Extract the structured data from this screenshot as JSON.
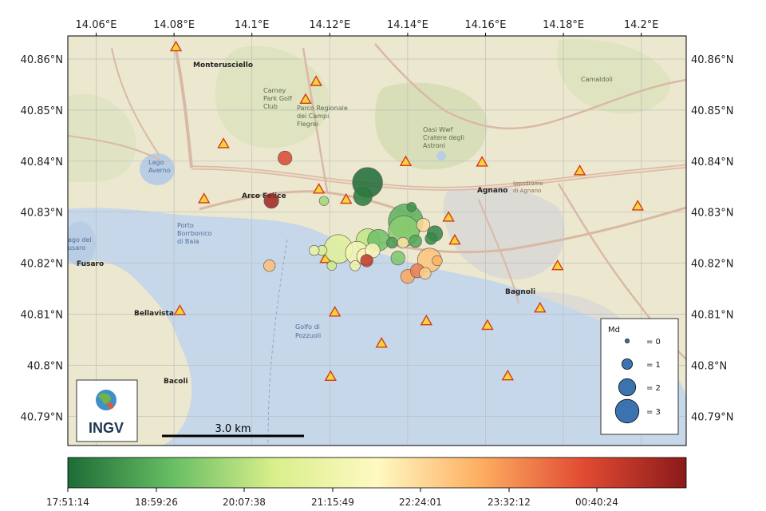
{
  "axes": {
    "lon_ticks": [
      "14.06°E",
      "14.08°E",
      "14.1°E",
      "14.12°E",
      "14.14°E",
      "14.16°E",
      "14.18°E",
      "14.2°E"
    ],
    "lat_ticks_left": [
      "40.86°N",
      "40.85°N",
      "40.84°N",
      "40.83°N",
      "40.82°N",
      "40.81°N",
      "40.8°N",
      "40.79°N"
    ],
    "lat_ticks_right": [
      "40.86°N",
      "40.85°N",
      "40.84°N",
      "40.83°N",
      "40.82°N",
      "40.81°N",
      "40.8°N",
      "40.79°N"
    ]
  },
  "places": {
    "monterusciello": "Monterusciello",
    "arco_felice": "Arco Felice",
    "agnano": "Agnano",
    "bagnoli": "Bagnoli",
    "bellavista": "Bellavista",
    "bacoli": "Bacoli",
    "fusaro": "Fusaro",
    "camaldoli": "Camaldoli",
    "lago_averno": "Lago\nAverno",
    "golfo": "Golfo di\nPozzuoli",
    "oasi": "Oasi Wwf\nCratere degli\nAstroni",
    "parco": "Parco Regionale\ndei Campi\nFlegrei",
    "golf": "Carney\nPark Golf\nClub",
    "ippodromo": "Ippodromo\ndi Agnano",
    "porto": "Porto\nBorrbonico\ndi Baia",
    "lago_del": "ago del\nusaro"
  },
  "scale_bar": {
    "label": "3.0 km"
  },
  "logo": {
    "text": "INGV"
  },
  "legend": {
    "title": "Md",
    "entries": [
      {
        "label": "= 0",
        "md": 0
      },
      {
        "label": "= 1",
        "md": 1
      },
      {
        "label": "= 2",
        "md": 2
      },
      {
        "label": "= 3",
        "md": 3
      }
    ]
  },
  "colorbar": {
    "colors": [
      "#1d6b36",
      "#66bd63",
      "#d9ef8b",
      "#fff9c2",
      "#fdae61",
      "#e24b33",
      "#8b1a1a"
    ],
    "ticks": [
      "17:51:14",
      "18:59:26",
      "20:07:38",
      "21:15:49",
      "22:24:01",
      "23:32:12",
      "00:40:24"
    ]
  },
  "stations": [
    {
      "lon": 14.0805,
      "lat": 40.8624
    },
    {
      "lon": 14.1165,
      "lat": 40.8556
    },
    {
      "lon": 14.1138,
      "lat": 40.8521
    },
    {
      "lon": 14.0927,
      "lat": 40.8434
    },
    {
      "lon": 14.0877,
      "lat": 40.8326
    },
    {
      "lon": 14.1172,
      "lat": 40.8345
    },
    {
      "lon": 14.1242,
      "lat": 40.8325
    },
    {
      "lon": 14.1395,
      "lat": 40.8399
    },
    {
      "lon": 14.1591,
      "lat": 40.8398
    },
    {
      "lon": 14.1842,
      "lat": 40.8381
    },
    {
      "lon": 14.1991,
      "lat": 40.8312
    },
    {
      "lon": 14.1505,
      "lat": 40.829
    },
    {
      "lon": 14.1521,
      "lat": 40.8245
    },
    {
      "lon": 14.1189,
      "lat": 40.8209
    },
    {
      "lon": 14.1785,
      "lat": 40.8195
    },
    {
      "lon": 14.0815,
      "lat": 40.8107
    },
    {
      "lon": 14.1213,
      "lat": 40.8104
    },
    {
      "lon": 14.174,
      "lat": 40.8112
    },
    {
      "lon": 14.1448,
      "lat": 40.8087
    },
    {
      "lon": 14.1605,
      "lat": 40.8078
    },
    {
      "lon": 14.1333,
      "lat": 40.8043
    },
    {
      "lon": 14.1202,
      "lat": 40.7978
    },
    {
      "lon": 14.1657,
      "lat": 40.7979
    },
    {
      "lon": 14.1395,
      "lat": 40.8272
    }
  ],
  "events": [
    {
      "lon": 14.1297,
      "lat": 40.8358,
      "md": 3.3,
      "t": 0.0
    },
    {
      "lon": 14.1285,
      "lat": 40.8331,
      "md": 1.8,
      "t": 0.03
    },
    {
      "lon": 14.1395,
      "lat": 40.8282,
      "md": 3.9,
      "t": 0.14
    },
    {
      "lon": 14.139,
      "lat": 40.8263,
      "md": 3.4,
      "t": 0.22
    },
    {
      "lon": 14.1298,
      "lat": 40.8244,
      "md": 2.5,
      "t": 0.3
    },
    {
      "lon": 14.1325,
      "lat": 40.8245,
      "md": 2.2,
      "t": 0.18
    },
    {
      "lon": 14.1222,
      "lat": 40.8228,
      "md": 3.1,
      "t": 0.37
    },
    {
      "lon": 14.127,
      "lat": 40.822,
      "md": 2.4,
      "t": 0.45
    },
    {
      "lon": 14.129,
      "lat": 40.8213,
      "md": 1.5,
      "t": 0.52
    },
    {
      "lon": 14.131,
      "lat": 40.8225,
      "md": 1.3,
      "t": 0.48
    },
    {
      "lon": 14.1375,
      "lat": 40.821,
      "md": 1.2,
      "t": 0.2
    },
    {
      "lon": 14.1456,
      "lat": 40.8206,
      "md": 2.5,
      "t": 0.62
    },
    {
      "lon": 14.147,
      "lat": 40.8258,
      "md": 1.4,
      "t": 0.05
    },
    {
      "lon": 14.144,
      "lat": 40.8275,
      "md": 1.1,
      "t": 0.57
    },
    {
      "lon": 14.146,
      "lat": 40.8248,
      "md": 0.9,
      "t": 0.06
    },
    {
      "lon": 14.142,
      "lat": 40.8243,
      "md": 1.0,
      "t": 0.12
    },
    {
      "lon": 14.14,
      "lat": 40.8174,
      "md": 1.2,
      "t": 0.68
    },
    {
      "lon": 14.1425,
      "lat": 40.8185,
      "md": 1.2,
      "t": 0.75
    },
    {
      "lon": 14.1445,
      "lat": 40.818,
      "md": 0.9,
      "t": 0.6
    },
    {
      "lon": 14.1476,
      "lat": 40.8205,
      "md": 0.7,
      "t": 0.66
    },
    {
      "lon": 14.1295,
      "lat": 40.8205,
      "md": 1.0,
      "t": 0.9
    },
    {
      "lon": 14.105,
      "lat": 40.8322,
      "md": 1.3,
      "t": 0.97
    },
    {
      "lon": 14.1085,
      "lat": 40.8406,
      "md": 1.2,
      "t": 0.85
    },
    {
      "lon": 14.1045,
      "lat": 40.8195,
      "md": 0.9,
      "t": 0.63
    },
    {
      "lon": 14.118,
      "lat": 40.8225,
      "md": 0.7,
      "t": 0.35
    },
    {
      "lon": 14.116,
      "lat": 40.8225,
      "md": 0.7,
      "t": 0.4
    },
    {
      "lon": 14.1265,
      "lat": 40.8195,
      "md": 0.7,
      "t": 0.42
    },
    {
      "lon": 14.136,
      "lat": 40.824,
      "md": 0.8,
      "t": 0.1
    },
    {
      "lon": 14.1205,
      "lat": 40.8195,
      "md": 0.6,
      "t": 0.32
    },
    {
      "lon": 14.1185,
      "lat": 40.8322,
      "md": 0.6,
      "t": 0.25
    },
    {
      "lon": 14.1388,
      "lat": 40.824,
      "md": 0.8,
      "t": 0.55
    },
    {
      "lon": 14.141,
      "lat": 40.831,
      "md": 0.6,
      "t": 0.08
    }
  ]
}
